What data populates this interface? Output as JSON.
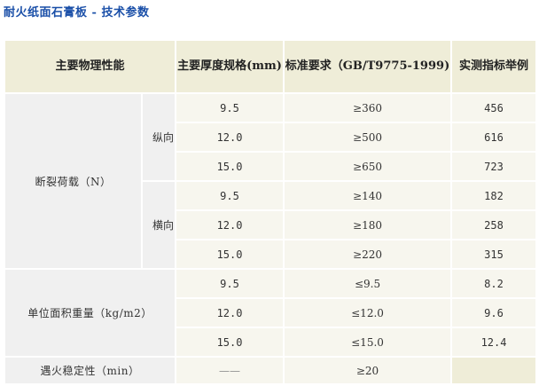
{
  "page": {
    "title": "耐火纸面石膏板 - 技术参数"
  },
  "table": {
    "headers": {
      "property": "主要物理性能",
      "thickness": "主要厚度规格(mm)",
      "standard": "标准要求（GB/T9775-1999)",
      "measured": "实测指标举例"
    },
    "breaking_load": {
      "label": "断裂荷载（N）",
      "longitudinal": {
        "label": "纵向",
        "rows": [
          {
            "thickness": "9.5",
            "standard": "≥360",
            "measured": "456"
          },
          {
            "thickness": "12.0",
            "standard": "≥500",
            "measured": "616"
          },
          {
            "thickness": "15.0",
            "standard": "≥650",
            "measured": "723"
          }
        ]
      },
      "transverse": {
        "label": "横向",
        "rows": [
          {
            "thickness": "9.5",
            "standard": "≥140",
            "measured": "182"
          },
          {
            "thickness": "12.0",
            "standard": "≥180",
            "measured": "258"
          },
          {
            "thickness": "15.0",
            "standard": "≥220",
            "measured": "315"
          }
        ]
      }
    },
    "unit_weight": {
      "label": "单位面积重量（kg/m2）",
      "rows": [
        {
          "thickness": "9.5",
          "standard": "≤9.5",
          "measured": "8.2"
        },
        {
          "thickness": "12.0",
          "standard": "≤12.0",
          "measured": "9.6"
        },
        {
          "thickness": "15.0",
          "standard": "≤15.0",
          "measured": "12.4"
        }
      ]
    },
    "fire_stability": {
      "label": "遇火稳定性（min）",
      "thickness": "——",
      "standard": "≥20",
      "measured": ""
    }
  }
}
